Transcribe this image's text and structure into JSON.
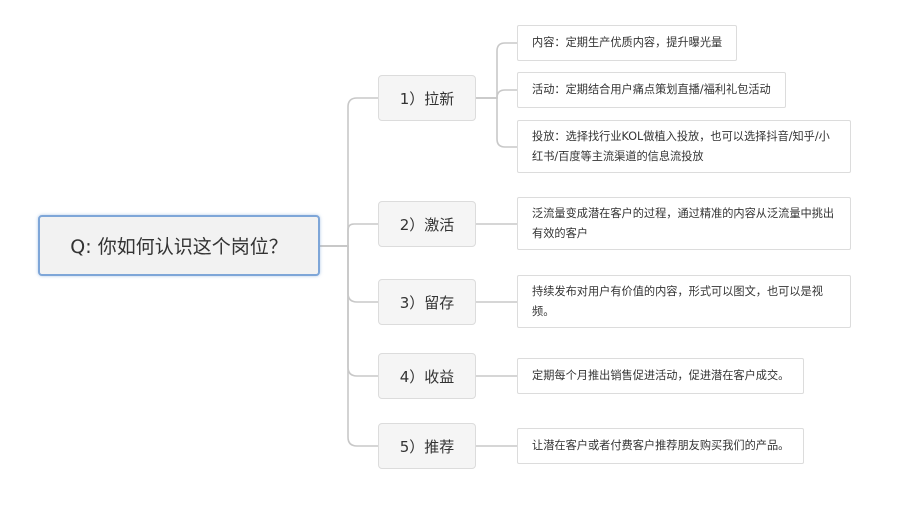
{
  "root": {
    "label": "Q: 你如何认识这个岗位？"
  },
  "branches": [
    {
      "label": "1）拉新",
      "leaves": [
        {
          "text": "内容：定期生产优质内容，提升曝光量"
        },
        {
          "text": "活动：定期结合用户痛点策划直播/福利礼包活动"
        },
        {
          "text": "投放：选择找行业KOL做植入投放，也可以选择抖音/知乎/小红书/百度等主流渠道的信息流投放"
        }
      ]
    },
    {
      "label": "2）激活",
      "leaves": [
        {
          "text": "泛流量变成潜在客户的过程，通过精准的内容从泛流量中挑出有效的客户"
        }
      ]
    },
    {
      "label": "3）留存",
      "leaves": [
        {
          "text": "持续发布对用户有价值的内容，形式可以图文，也可以是视频。"
        }
      ]
    },
    {
      "label": "4）收益",
      "leaves": [
        {
          "text": "定期每个月推出销售促进活动，促进潜在客户成交。"
        }
      ]
    },
    {
      "label": "5）推荐",
      "leaves": [
        {
          "text": "让潜在客户或者付费客户推荐朋友购买我们的产品。"
        }
      ]
    }
  ]
}
